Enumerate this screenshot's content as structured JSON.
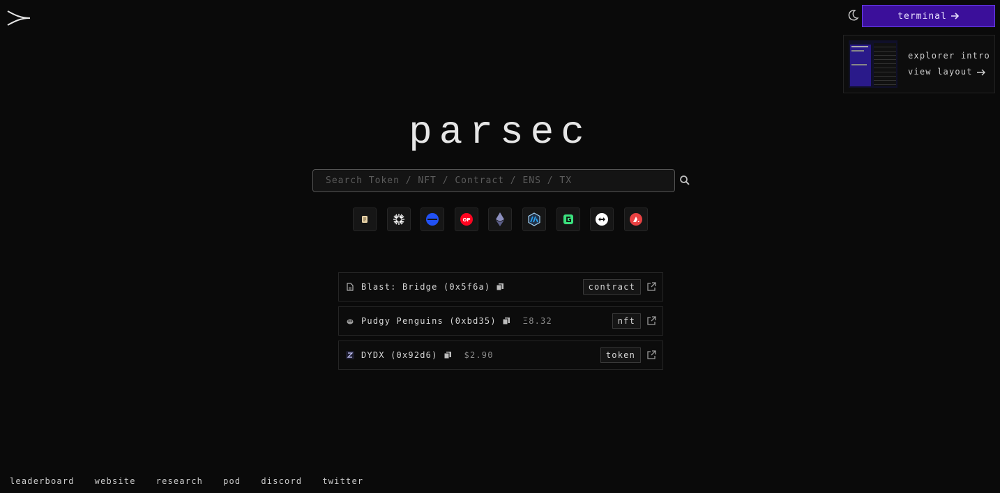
{
  "brand": {
    "name": "parsec"
  },
  "header": {
    "terminal_label": "terminal",
    "intro_card": {
      "title": "explorer intro",
      "link_label": "view layout"
    }
  },
  "search": {
    "placeholder": "Search Token / NFT / Contract / ENS / TX",
    "value": ""
  },
  "chains": [
    {
      "name": "scroll",
      "color": "#e8d3a8"
    },
    {
      "name": "celestia",
      "color": "#ffffff"
    },
    {
      "name": "base",
      "color": "#2151f5"
    },
    {
      "name": "optimism",
      "color": "#ff0420"
    },
    {
      "name": "ethereum",
      "color": "#8c8fbf"
    },
    {
      "name": "arbitrum",
      "color": "#28a0f0"
    },
    {
      "name": "gnosis",
      "color": "#3be27e"
    },
    {
      "name": "bnb",
      "color": "#ffffff"
    },
    {
      "name": "avalanche",
      "color": "#e84142"
    }
  ],
  "results": [
    {
      "label": "Blast: Bridge (0x5f6a)",
      "price": "",
      "badge": "contract",
      "icon": "document-icon"
    },
    {
      "label": "Pudgy Penguins (0xbd35)",
      "price": "Ξ8.32",
      "badge": "nft",
      "icon": "penguin-icon"
    },
    {
      "label": "DYDX (0x92d6)",
      "price": "$2.90",
      "badge": "token",
      "icon": "dydx-icon"
    }
  ],
  "footer": {
    "links": [
      "leaderboard",
      "website",
      "research",
      "pod",
      "discord",
      "twitter"
    ]
  },
  "colors": {
    "accent": "#3b0f9a",
    "background": "#0a0a0a"
  }
}
